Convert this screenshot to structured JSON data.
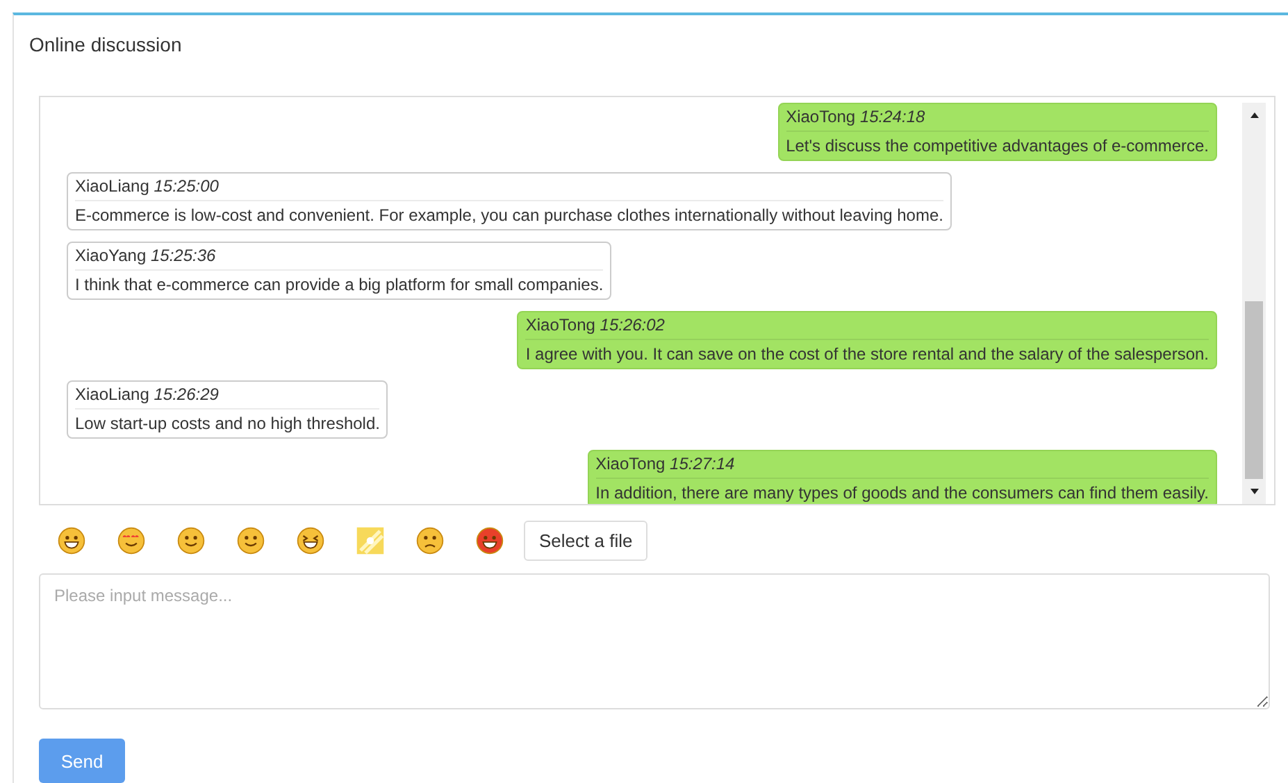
{
  "panel": {
    "title": "Online discussion"
  },
  "messages": [
    {
      "kind": "own",
      "sender": "XiaoTong",
      "time": "15:24:18",
      "text": "Let's discuss the competitive advantages of e-commerce."
    },
    {
      "kind": "other",
      "sender": "XiaoLiang",
      "time": "15:25:00",
      "text": "E-commerce is low-cost and convenient. For example, you can purchase clothes internationally without leaving home."
    },
    {
      "kind": "other",
      "sender": "XiaoYang",
      "time": "15:25:36",
      "text": "I think that e-commerce can provide a big platform for small companies."
    },
    {
      "kind": "own",
      "sender": "XiaoTong",
      "time": "15:26:02",
      "text": "I agree with you. It can save on the cost of the store rental and the salary of the salesperson."
    },
    {
      "kind": "other",
      "sender": "XiaoLiang",
      "time": "15:26:29",
      "text": "Low start-up costs and no high threshold."
    },
    {
      "kind": "own",
      "sender": "XiaoTong",
      "time": "15:27:14",
      "text": "In addition, there are many types of goods and the consumers can find them easily."
    }
  ],
  "file_button": "Select a file",
  "message_input": {
    "placeholder": "Please input message..."
  },
  "send_button": "Send"
}
